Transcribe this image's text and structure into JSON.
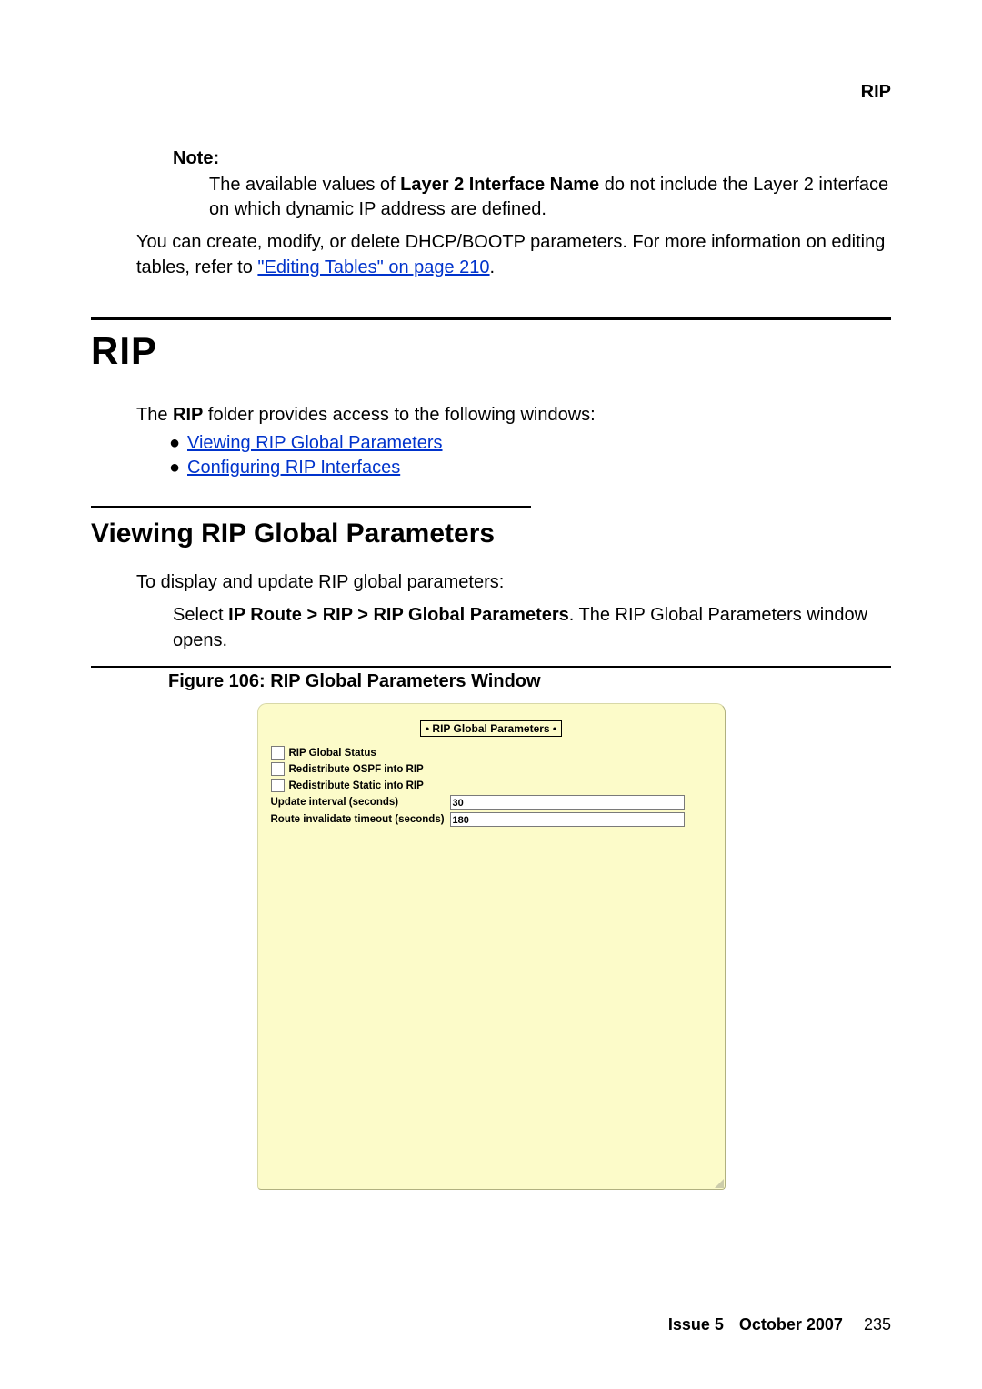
{
  "header": {
    "section": "RIP"
  },
  "note": {
    "label": "Note:",
    "body_1": "The available values of ",
    "body_bold": "Layer 2 Interface Name",
    "body_2": " do not include the Layer 2 interface on which dynamic IP address are defined."
  },
  "para1": {
    "pre": "You can create, modify, or delete DHCP/BOOTP parameters. For more information on editing tables, refer to ",
    "link": "\"Editing Tables\" on page 210",
    "post": "."
  },
  "h1": "RIP",
  "intro": {
    "pre": "The ",
    "bold": "RIP",
    "post": " folder provides access to the following windows:"
  },
  "links": [
    "Viewing RIP Global Parameters",
    "Configuring RIP Interfaces"
  ],
  "h2": "Viewing RIP Global Parameters",
  "sub_intro": "To display and update RIP global parameters:",
  "step": {
    "pre": "Select ",
    "bold": "IP Route > RIP > RIP Global Parameters",
    "post": ". The RIP Global Parameters window opens."
  },
  "figure_caption": "Figure 106: RIP Global Parameters Window",
  "window": {
    "title": "• RIP Global Parameters •",
    "fields": {
      "status": "RIP Global Status",
      "ospf": "Redistribute OSPF into RIP",
      "static": "Redistribute Static into RIP",
      "update_label": "Update interval (seconds)",
      "update_value": "30",
      "invalidate_label": "Route invalidate timeout (seconds)",
      "invalidate_value": "180"
    }
  },
  "footer": {
    "issue": "Issue 5",
    "date": "October 2007",
    "page": "235"
  }
}
